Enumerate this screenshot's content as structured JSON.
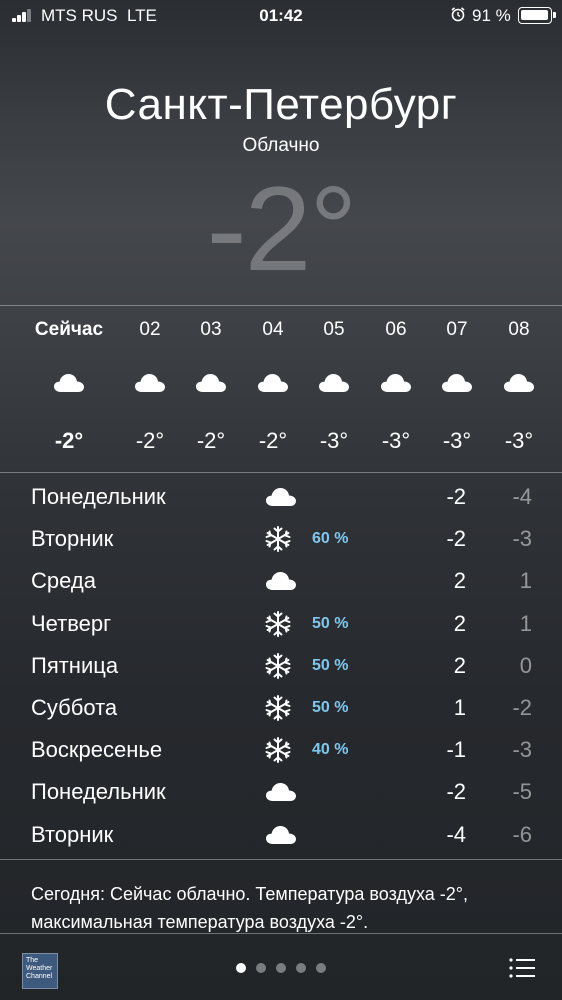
{
  "status_bar": {
    "carrier": "MTS RUS",
    "network": "LTE",
    "time": "01:42",
    "battery_percent": "91 %",
    "icons": [
      "signal-icon",
      "alarm-icon",
      "battery-icon"
    ]
  },
  "header": {
    "city": "Санкт-Петербург",
    "condition": "Облачно",
    "current_temp": "-2°"
  },
  "hourly": [
    {
      "label": "Сейчас",
      "icon": "cloud-icon",
      "temp": "-2°"
    },
    {
      "label": "02",
      "icon": "cloud-icon",
      "temp": "-2°"
    },
    {
      "label": "03",
      "icon": "cloud-icon",
      "temp": "-2°"
    },
    {
      "label": "04",
      "icon": "cloud-icon",
      "temp": "-2°"
    },
    {
      "label": "05",
      "icon": "cloud-icon",
      "temp": "-3°"
    },
    {
      "label": "06",
      "icon": "cloud-icon",
      "temp": "-3°"
    },
    {
      "label": "07",
      "icon": "cloud-icon",
      "temp": "-3°"
    },
    {
      "label": "08",
      "icon": "cloud-icon",
      "temp": "-3°"
    }
  ],
  "daily": [
    {
      "day": "Понедельник",
      "icon": "cloud-icon",
      "precip": "",
      "max": "-2",
      "min": "-4"
    },
    {
      "day": "Вторник",
      "icon": "snowflake-icon",
      "precip": "60 %",
      "max": "-2",
      "min": "-3"
    },
    {
      "day": "Среда",
      "icon": "cloud-icon",
      "precip": "",
      "max": "2",
      "min": "1"
    },
    {
      "day": "Четверг",
      "icon": "snowflake-icon",
      "precip": "50 %",
      "max": "2",
      "min": "1"
    },
    {
      "day": "Пятница",
      "icon": "snowflake-icon",
      "precip": "50 %",
      "max": "2",
      "min": "0"
    },
    {
      "day": "Суббота",
      "icon": "snowflake-icon",
      "precip": "50 %",
      "max": "1",
      "min": "-2"
    },
    {
      "day": "Воскресенье",
      "icon": "snowflake-icon",
      "precip": "40 %",
      "max": "-1",
      "min": "-3"
    },
    {
      "day": "Понедельник",
      "icon": "cloud-icon",
      "precip": "",
      "max": "-2",
      "min": "-5"
    },
    {
      "day": "Вторник",
      "icon": "cloud-icon",
      "precip": "",
      "max": "-4",
      "min": "-6"
    }
  ],
  "summary": "Сегодня: Сейчас облачно. Температура воздуха -2°, максимальная температура воздуха -2°.",
  "footer": {
    "logo_text": [
      "The",
      "Weather",
      "Channel"
    ],
    "page_count": 5,
    "active_page": 1
  },
  "colors": {
    "precip_blue": "#7ec8f0",
    "text": "#ffffff"
  }
}
